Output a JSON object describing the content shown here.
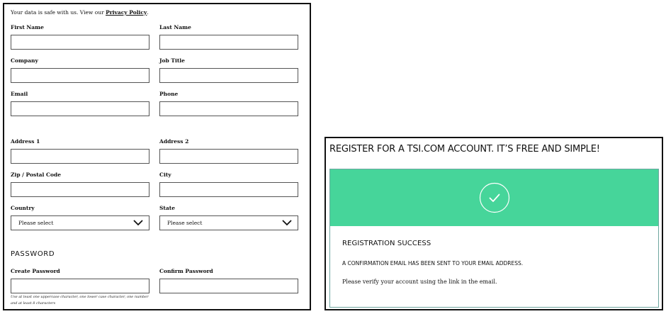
{
  "form": {
    "privacy_prefix": "Your data is safe with us. View our",
    "privacy_link": "Privacy Policy",
    "privacy_suffix": ".",
    "fields": {
      "first_name": {
        "label": "First Name",
        "value": ""
      },
      "last_name": {
        "label": "Last Name",
        "value": ""
      },
      "company": {
        "label": "Company",
        "value": ""
      },
      "job_title": {
        "label": "Job Title",
        "value": ""
      },
      "email": {
        "label": "Email",
        "value": ""
      },
      "phone": {
        "label": "Phone",
        "value": ""
      },
      "address1": {
        "label": "Address 1",
        "value": ""
      },
      "address2": {
        "label": "Address 2",
        "value": ""
      },
      "zip": {
        "label": "Zip / Postal Code",
        "value": ""
      },
      "city": {
        "label": "City",
        "value": ""
      },
      "country": {
        "label": "Country",
        "selected": "Please select"
      },
      "state": {
        "label": "State",
        "selected": "Please select"
      },
      "create_password": {
        "label": "Create Password",
        "value": ""
      },
      "confirm_password": {
        "label": "Confirm Password",
        "value": ""
      }
    },
    "password_heading": "PASSWORD",
    "password_hint": "Use at least one uppercase character, one lower case character, one number and at least 8 characters"
  },
  "success": {
    "title": "REGISTER FOR A TSI.COM ACCOUNT. IT’S FREE AND SIMPLE!",
    "banner_color": "#46d59a",
    "icon": "check-circle-icon",
    "heading": "REGISTRATION SUCCESS",
    "line1": "A CONFIRMATION EMAIL HAS BEEN SENT TO YOUR EMAIL ADDRESS.",
    "line2": "Please verify your account using the link in the email."
  }
}
